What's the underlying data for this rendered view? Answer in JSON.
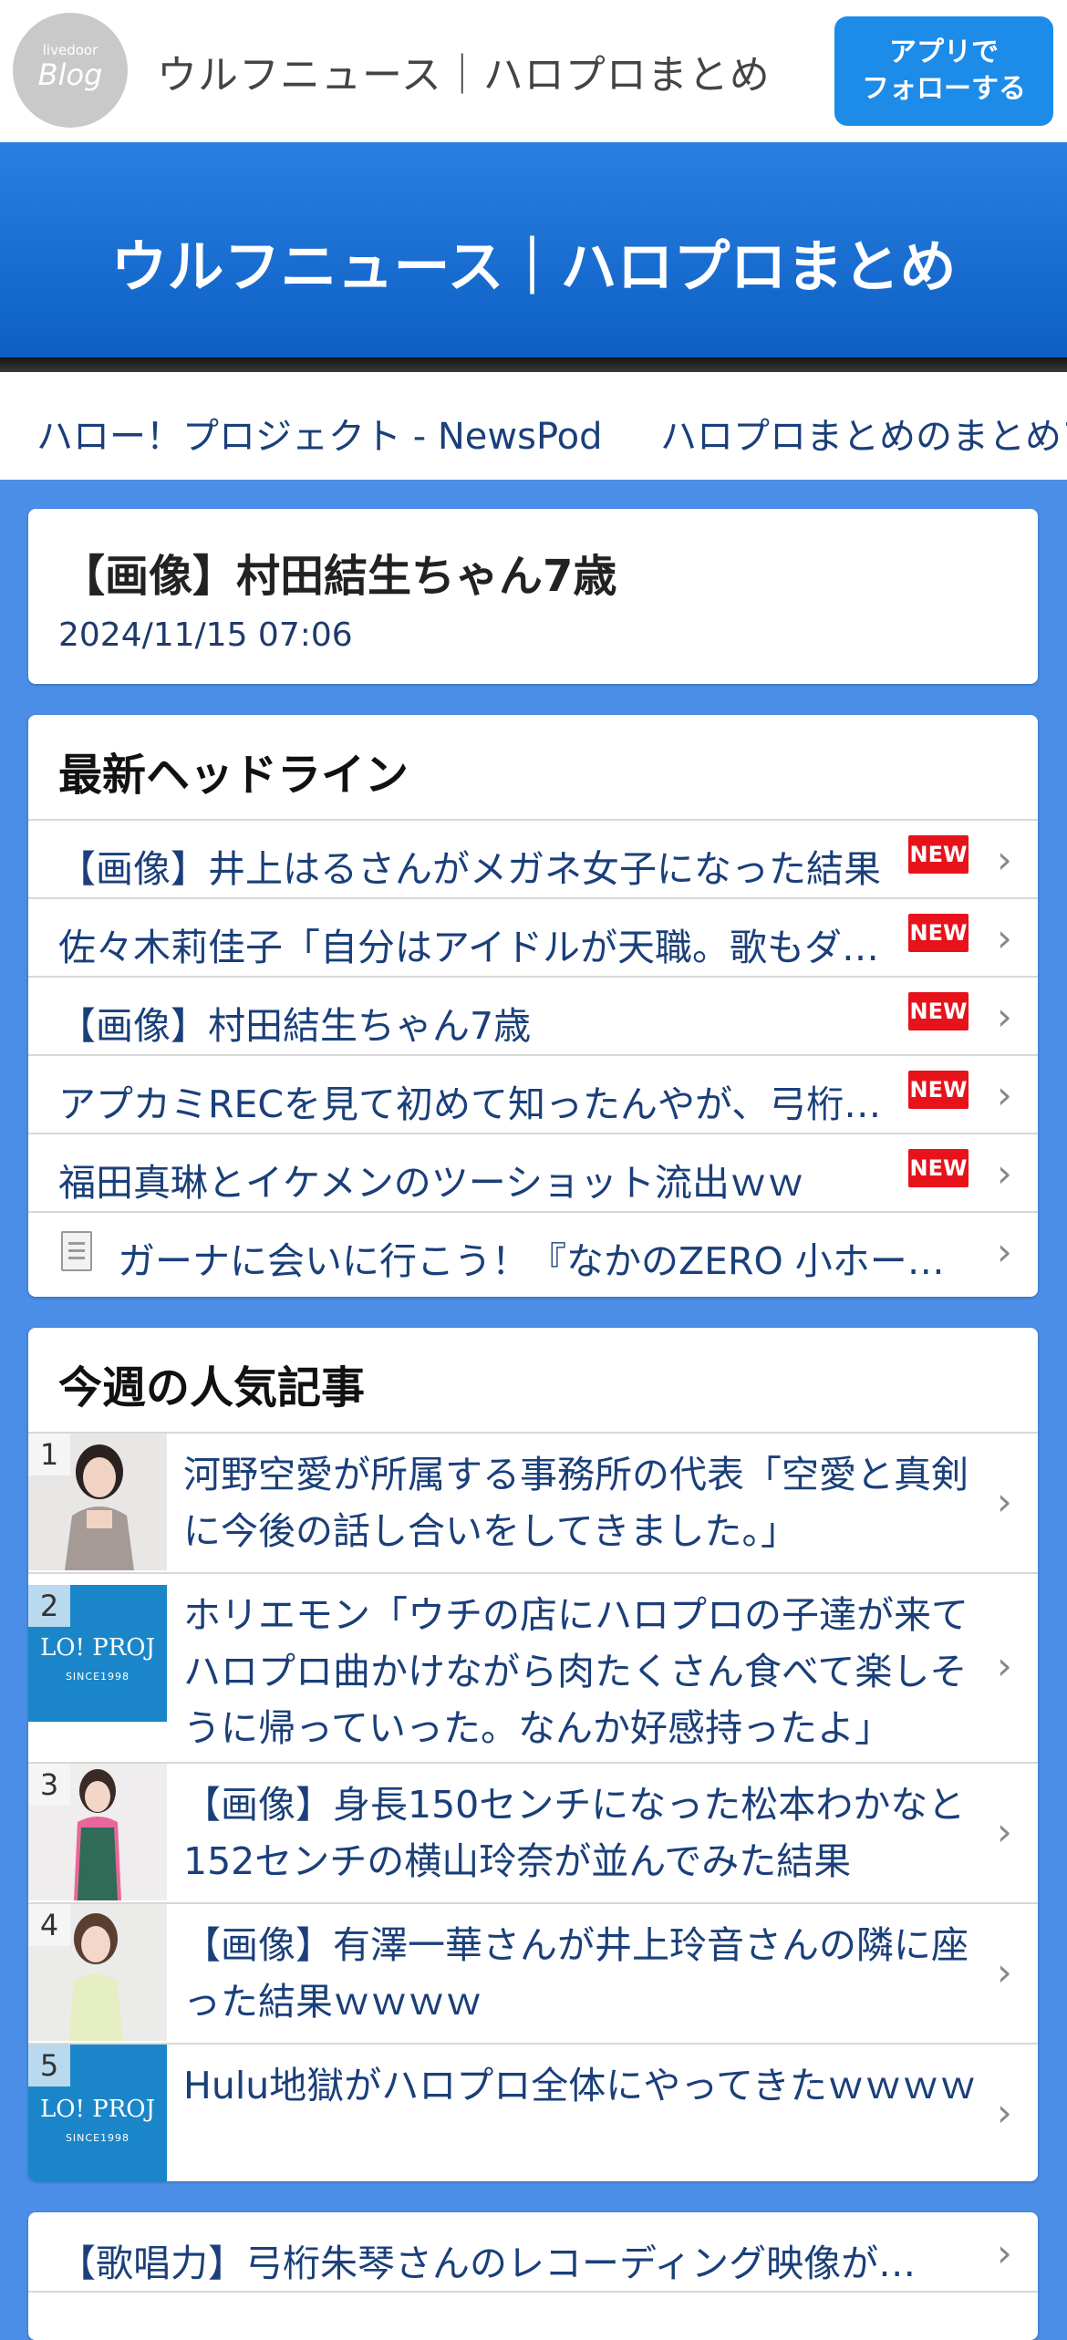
{
  "topbar": {
    "logo_small": "livedoor",
    "logo_big": "Blog",
    "site_name": "ウルフニュース｜ハロプロまとめ",
    "follow_line1": "アプリで",
    "follow_line2": "フォローする"
  },
  "banner": {
    "title": "ウルフニュース｜ハロプロまとめ"
  },
  "links": [
    "ハロー！プロジェクト - NewsPod",
    "ハロプロまとめのまとめア"
  ],
  "article": {
    "title": "【画像】村田結生ちゃん7歳",
    "date": "2024/11/15 07:06"
  },
  "headlines": {
    "title": "最新ヘッドライン",
    "badge": "NEW",
    "items": [
      {
        "text": "【画像】井上はるさんがメガネ女子になった結果"
      },
      {
        "text": "佐々木莉佳子「自分はアイドルが天職。歌もダ…"
      },
      {
        "text": "【画像】村田結生ちゃん7歳"
      },
      {
        "text": "アプカミRECを見て初めて知ったんやが、弓桁…"
      },
      {
        "text": "福田真琳とイケメンのツーショット流出ｗｗ"
      },
      {
        "text": "ガーナに会いに行こう！『なかのZERO 小ホー…"
      }
    ]
  },
  "popular": {
    "title": "今週の人気記事",
    "thumb_logo_text": "LO! PROJ",
    "thumb_logo_sub": "SINCE1998",
    "items": [
      {
        "rank": "1",
        "text": "河野空愛が所属する事務所の代表「空愛と真剣に今後の話し合いをしてきました。」"
      },
      {
        "rank": "2",
        "text": "ホリエモン「ウチの店にハロプロの子達が来てハロプロ曲かけながら肉たくさん食べて楽しそうに帰っていった。なんか好感持ったよ」"
      },
      {
        "rank": "3",
        "text": "【画像】身長150センチになった松本わかなと152センチの横山玲奈が並んでみた結果"
      },
      {
        "rank": "4",
        "text": "【画像】有澤一華さんが井上玲音さんの隣に座った結果ｗｗｗｗ"
      },
      {
        "rank": "5",
        "text": "Hulu地獄がハロプロ全体にやってきたｗｗｗｗ"
      }
    ]
  },
  "more": {
    "first": "【歌唱力】弓桁朱琴さんのレコーディング映像が…"
  },
  "colors": {
    "brand_blue": "#1d8be8",
    "new_red": "#e8121b",
    "link_navy": "#1a3f7a"
  }
}
